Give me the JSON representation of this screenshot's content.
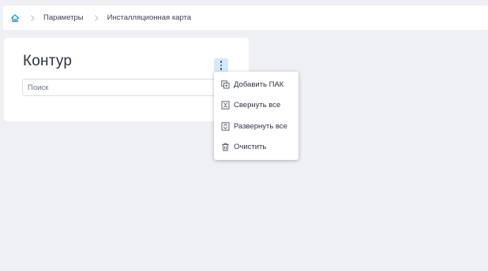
{
  "breadcrumb": {
    "home_icon": "home-icon",
    "items": [
      {
        "label": "Параметры"
      },
      {
        "label": "Инсталляционная карта"
      }
    ]
  },
  "panel": {
    "title": "Контур",
    "more_icon": "kebab-vertical-icon",
    "search": {
      "placeholder": "Поиск",
      "value": ""
    }
  },
  "menu": {
    "items": [
      {
        "label": "Добавить ПАК",
        "icon": "add-copy-icon"
      },
      {
        "label": "Свернуть все",
        "icon": "collapse-all-icon"
      },
      {
        "label": "Развернуть все",
        "icon": "expand-all-icon"
      },
      {
        "label": "Очистить",
        "icon": "trash-icon"
      }
    ]
  },
  "colors": {
    "background": "#eef0f4",
    "accent": "#1f7fd6",
    "kebab_bg": "#d8e8fb",
    "text": "#2c3340"
  }
}
